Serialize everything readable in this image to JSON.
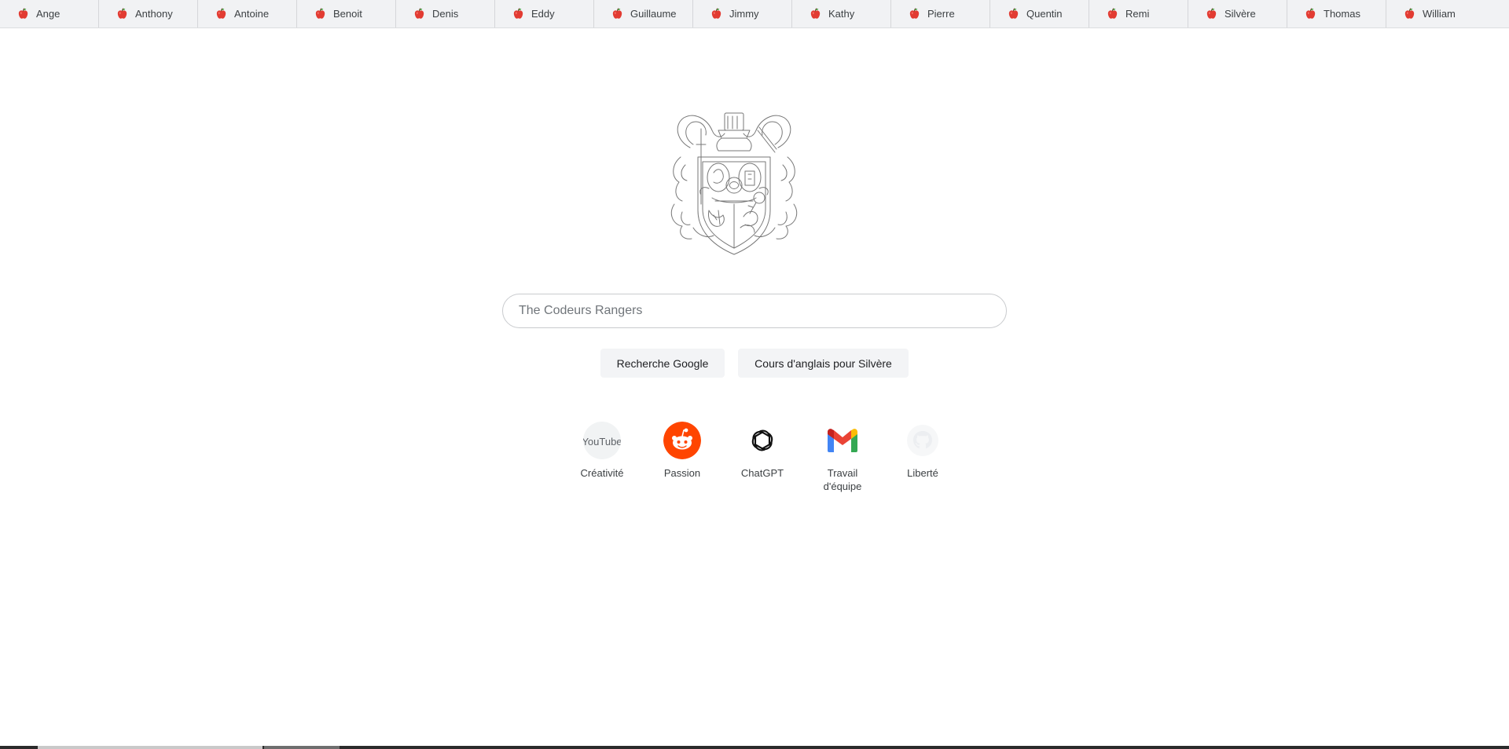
{
  "bookmarks": [
    {
      "label": "Ange"
    },
    {
      "label": "Anthony"
    },
    {
      "label": "Antoine"
    },
    {
      "label": "Benoit"
    },
    {
      "label": "Denis"
    },
    {
      "label": "Eddy"
    },
    {
      "label": "Guillaume"
    },
    {
      "label": "Jimmy"
    },
    {
      "label": "Kathy"
    },
    {
      "label": "Pierre"
    },
    {
      "label": "Quentin"
    },
    {
      "label": "Remi"
    },
    {
      "label": "Silvère"
    },
    {
      "label": "Thomas"
    },
    {
      "label": "William"
    }
  ],
  "bookmark_icon": "apple-icon",
  "search": {
    "placeholder": "The Codeurs Rangers",
    "value": ""
  },
  "buttons": {
    "google": "Recherche Google",
    "english": "Cours d'anglais pour Silvère"
  },
  "shortcuts": [
    {
      "label": "Créativité",
      "icon": "youtube-icon",
      "alt": "YouTube"
    },
    {
      "label": "Passion",
      "icon": "reddit-icon"
    },
    {
      "label": "ChatGPT",
      "icon": "chatgpt-icon"
    },
    {
      "label": "Travail d'équipe",
      "icon": "gmail-icon"
    },
    {
      "label": "Liberté",
      "icon": "github-icon"
    }
  ],
  "colors": {
    "apple_red": "#e23b32",
    "reddit_orange": "#ff4500",
    "bar_background": "#f1f2f4"
  }
}
